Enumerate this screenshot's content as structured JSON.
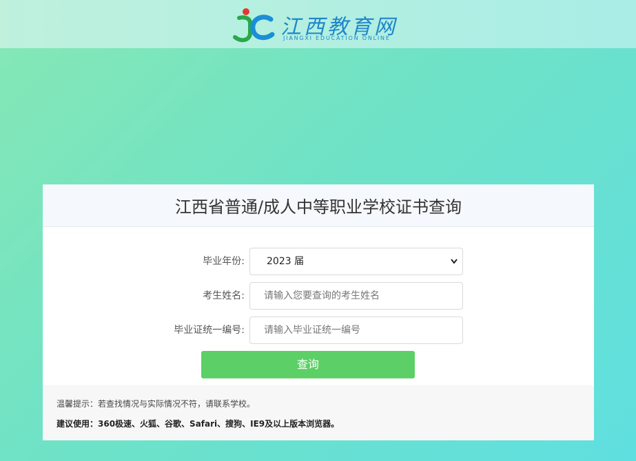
{
  "header": {
    "logo_cn": "江西教育网",
    "logo_en": "JIANGXI EDUCATION ONLINE"
  },
  "panel": {
    "title": "江西省普通/成人中等职业学校证书查询"
  },
  "form": {
    "year_label": "毕业年份:",
    "year_value": "2023 届",
    "name_label": "考生姓名:",
    "name_placeholder": "请输入您要查询的考生姓名",
    "cert_label": "毕业证统一编号:",
    "cert_placeholder": "请输入毕业证统一编号",
    "submit_label": "查询"
  },
  "notice": {
    "tip": "温馨提示：若查找情况与实际情况不符，请联系学校。",
    "browser": "建议使用：360极速、火狐、谷歌、Safari、搜狗、IE9及以上版本浏览器。"
  },
  "colors": {
    "accent_green": "#5cd066",
    "brand_blue": "#1f86c9"
  }
}
